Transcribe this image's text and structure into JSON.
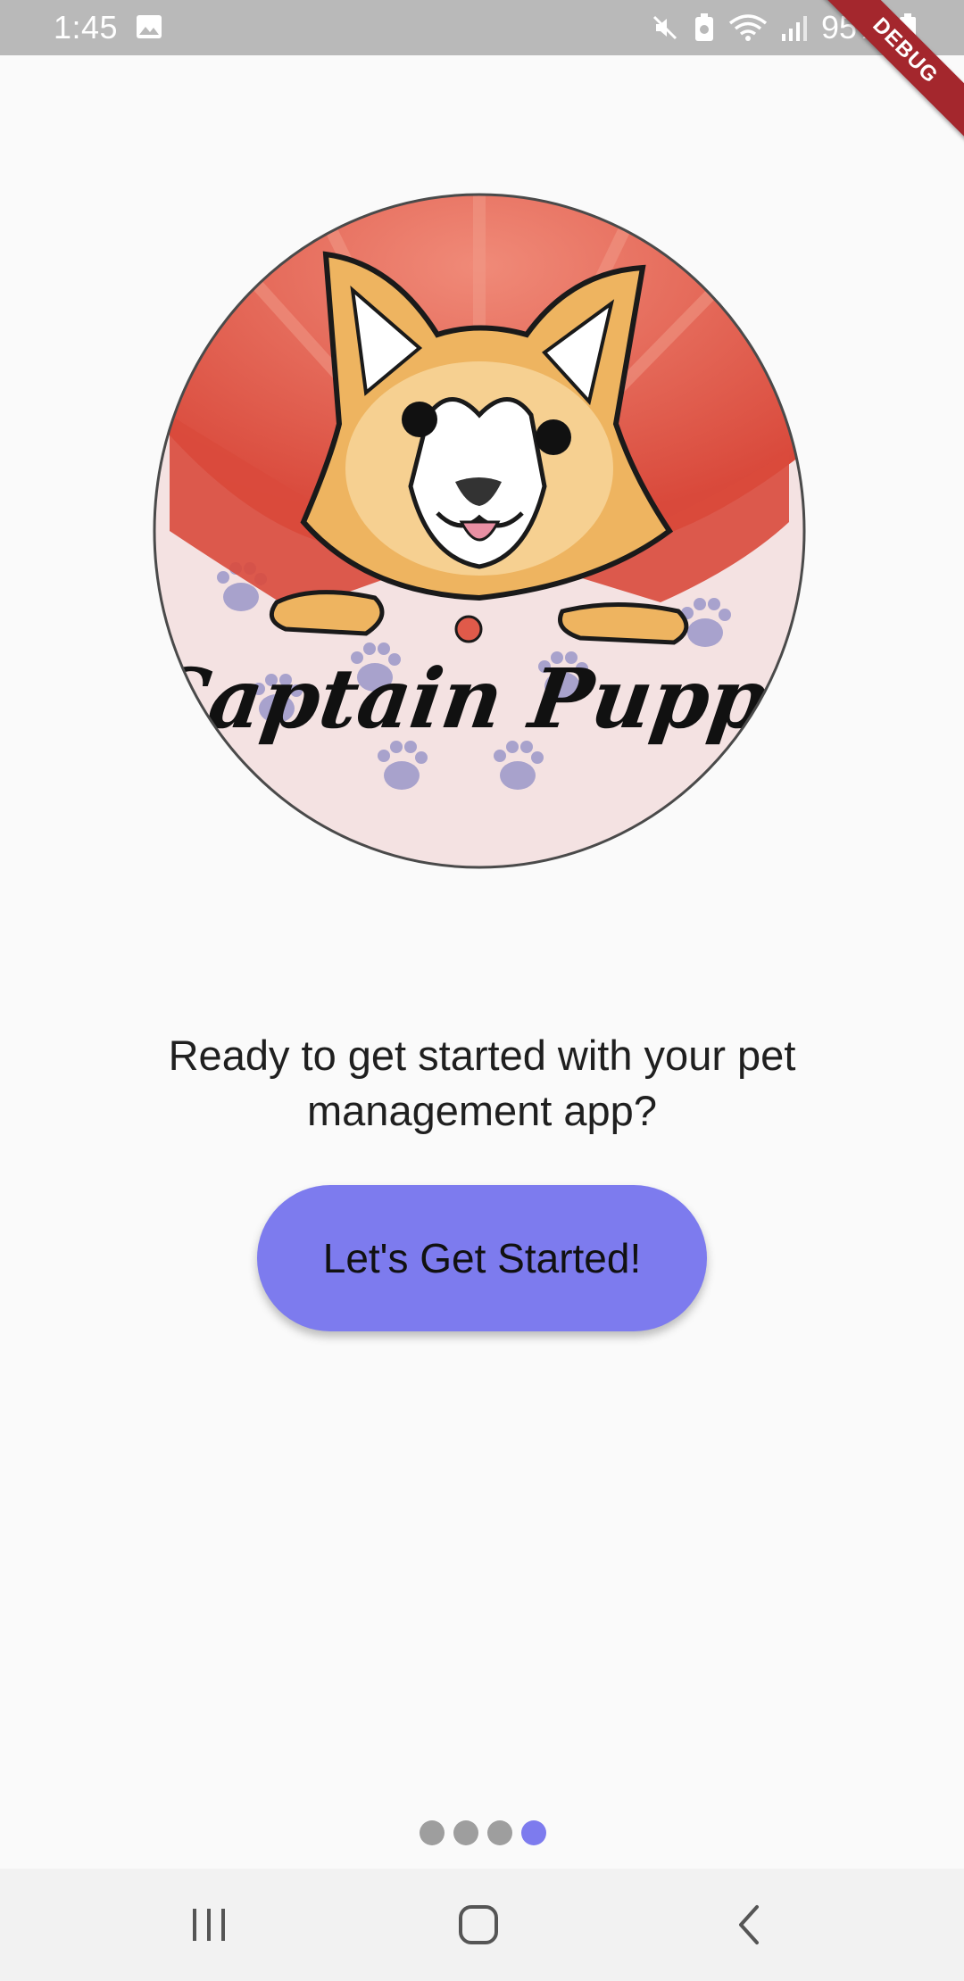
{
  "status_bar": {
    "time": "1:45",
    "battery": "95%",
    "icons": [
      "gallery-icon",
      "mute-icon",
      "battery-saver-icon",
      "wifi-icon",
      "signal-icon",
      "battery-icon"
    ],
    "debug_banner": "DEBUG"
  },
  "logo": {
    "text": "Captain Puppy",
    "colors": {
      "sun_red": "#e15a4a",
      "dog_orange": "#eeb460",
      "paw_purple": "#9b97c9",
      "bg_pink": "#f4e2e2"
    }
  },
  "onboarding": {
    "prompt": "Ready to get started with your pet management app?",
    "cta_label": "Let's Get Started!",
    "page_index": 4,
    "page_count": 4,
    "accent_color": "#7d7bee"
  },
  "nav_bar": {
    "buttons": [
      "recents-icon",
      "home-icon",
      "back-icon"
    ]
  }
}
